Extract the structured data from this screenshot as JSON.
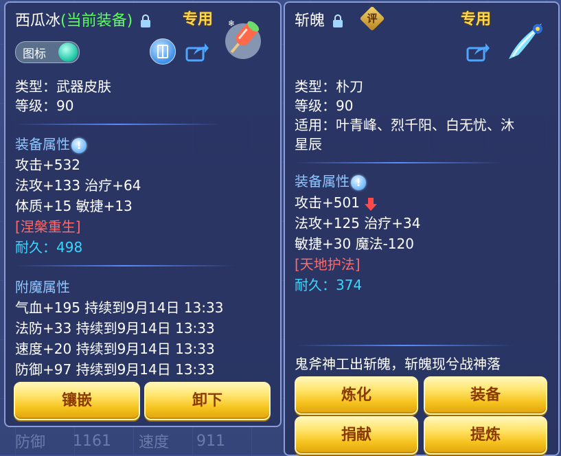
{
  "background": {
    "stats": [
      "防御",
      "1161",
      "速度",
      "911"
    ]
  },
  "left": {
    "name": "西瓜冰",
    "equipped": "(当前装备)",
    "exclusive": "专用",
    "toggle_label": "图标",
    "type": "类型：武器皮肤",
    "level": "等级：90",
    "attr_header": "装备属性",
    "attrs": [
      "攻击+532",
      "法攻+133 治疗+64",
      "体质+15 敏捷+13"
    ],
    "special": "[涅槃重生]",
    "durability": "耐久：498",
    "enchant_header": "附魔属性",
    "enchants": [
      "气血+195 持续到9月14日 13:33",
      "法防+33 持续到9月14日 13:33",
      "速度+20 持续到9月14日 13:33",
      "防御+97 持续到9月14日 13:33"
    ],
    "buttons": [
      "镶嵌",
      "卸下"
    ]
  },
  "right": {
    "name": "斩魄",
    "rate_label": "评",
    "exclusive": "专用",
    "type": "类型：朴刀",
    "level": "等级：90",
    "fit_line1": "适用：叶青峰、烈千阳、白无忧、沐",
    "fit_line2": "星辰",
    "attr_header": "装备属性",
    "attrs": [
      "攻击+501",
      "法攻+125 治疗+34",
      "敏捷+30 魔法-120"
    ],
    "special": "[天地护法]",
    "durability": "耐久：374",
    "flavor": "鬼斧神工出斩魄，斩魄现兮战神落",
    "buttons": [
      "炼化",
      "装备",
      "捐献",
      "提炼"
    ]
  },
  "colors": {
    "green": "#5bff5b",
    "cyan": "#39d9ff",
    "red": "#ff6a6a",
    "gold": "#ffd84a"
  }
}
